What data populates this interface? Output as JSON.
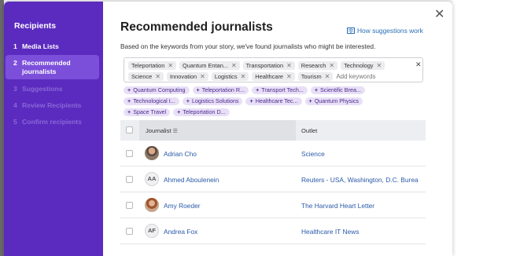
{
  "sidebar": {
    "title": "Recipients",
    "steps": [
      {
        "num": "1",
        "label": "Media Lists"
      },
      {
        "num": "2",
        "label": "Recommended journalists"
      },
      {
        "num": "3",
        "label": "Suggestions"
      },
      {
        "num": "4",
        "label": "Review Recipients"
      },
      {
        "num": "5",
        "label": "Confirm recipients"
      }
    ]
  },
  "modal": {
    "close_glyph": "✕",
    "title": "Recommended journalists",
    "how_link": "How suggestions work",
    "description": "Based on the keywords from your story, we've found journalists who might be interested."
  },
  "keywords": {
    "chips": [
      "Teleportation",
      "Quantum Entan...",
      "Transportation",
      "Research",
      "Technology",
      "Science",
      "Innovation",
      "Logistics",
      "Healthcare",
      "Tourism"
    ],
    "placeholder": "Add keywords",
    "clear_glyph": "✕",
    "remove_glyph": "✕"
  },
  "suggestions": {
    "plus": "+",
    "chips": [
      "Quantum Computing",
      "Teleportation R...",
      "Transport Tech...",
      "Scientific Brea...",
      "Technological I...",
      "Logistics Solutions",
      "Healthcare Tec...",
      "Quantum Physics",
      "Space Travel",
      "Teleportation D..."
    ]
  },
  "table": {
    "col_journalist": "Journalist",
    "col_outlet": "Outlet",
    "sort_glyph": "☰",
    "rows": [
      {
        "initials": "",
        "name": "Adrian Cho",
        "outlet": "Science"
      },
      {
        "initials": "AA",
        "name": "Ahmed Aboulenein",
        "outlet": "Reuters - USA, Washington, D.C. Burea"
      },
      {
        "initials": "",
        "name": "Amy Roeder",
        "outlet": "The Harvard Heart Letter"
      },
      {
        "initials": "AF",
        "name": "Andrea Fox",
        "outlet": "Healthcare IT News"
      }
    ]
  },
  "colors": {
    "sidebar": "#5b2bbf",
    "active_step": "#7c4fdb",
    "link": "#2a5aa8",
    "suggestion_bg": "#e8dff7"
  }
}
